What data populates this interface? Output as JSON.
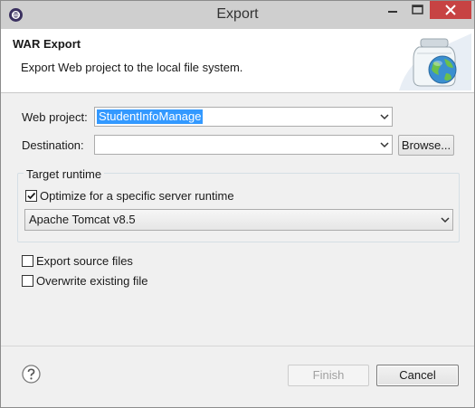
{
  "window": {
    "title": "Export"
  },
  "header": {
    "title": "WAR Export",
    "description": "Export Web project to the local file system."
  },
  "form": {
    "web_project_label": "Web project:",
    "web_project_value": "StudentInfoManage",
    "destination_label": "Destination:",
    "destination_value": "",
    "browse_label": "Browse..."
  },
  "target_runtime": {
    "group_title": "Target runtime",
    "optimize_label": "Optimize for a specific server runtime",
    "optimize_checked": true,
    "runtime_value": "Apache Tomcat v8.5"
  },
  "options": {
    "export_source_label": "Export source files",
    "export_source_checked": false,
    "overwrite_label": "Overwrite existing file",
    "overwrite_checked": false
  },
  "buttons": {
    "finish_label": "Finish",
    "cancel_label": "Cancel"
  },
  "icons": {
    "app": "eclipse-icon",
    "header": "jar-globe-icon",
    "help": "help-icon"
  }
}
